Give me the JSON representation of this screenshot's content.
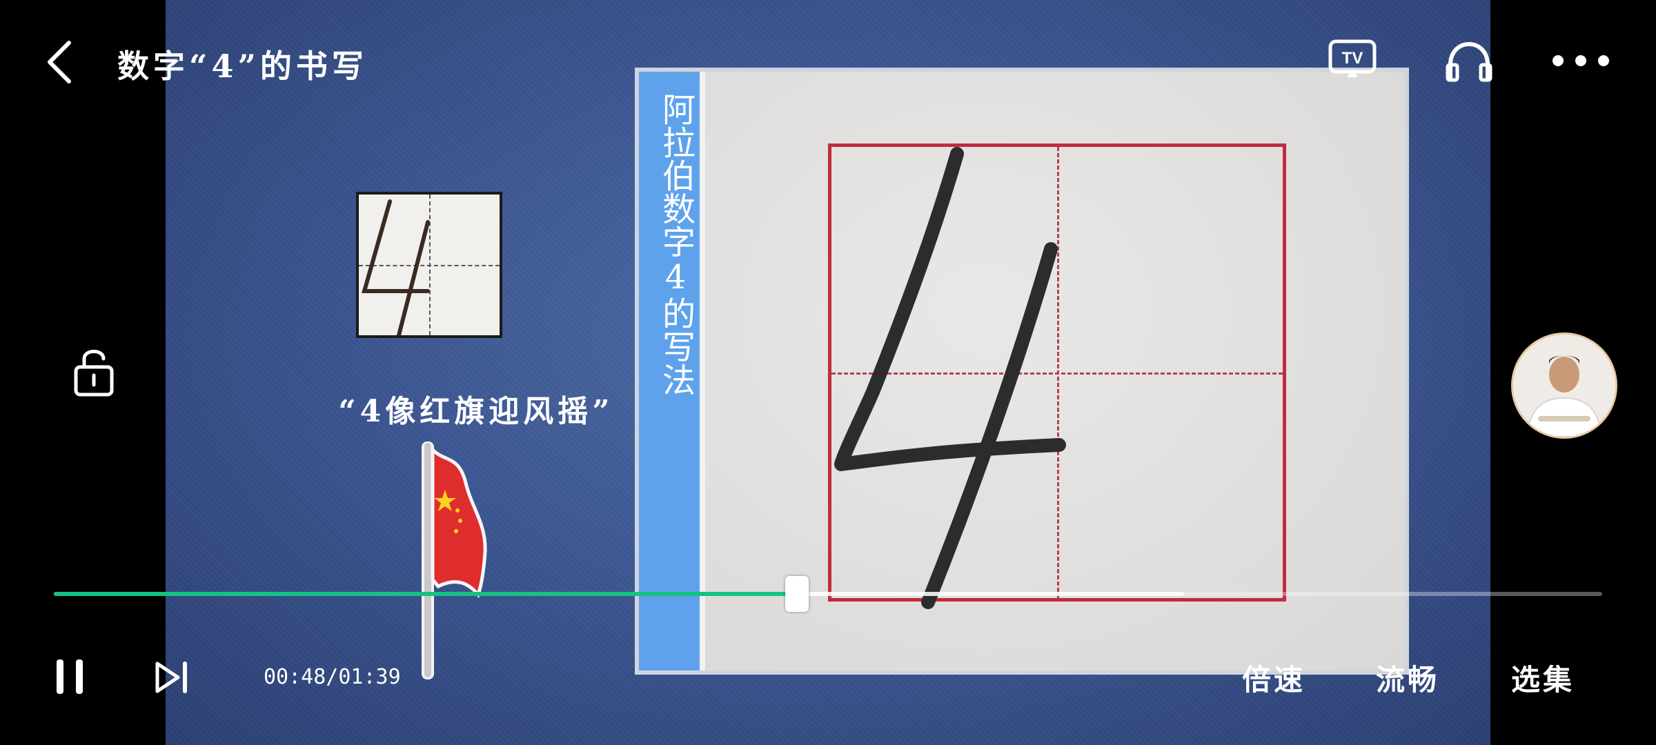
{
  "header": {
    "title": "数字“4”的书写"
  },
  "icons": {
    "back": "back-arrow-icon",
    "cast": "tv-cast-icon",
    "audio": "headphones-icon",
    "more": "more-dots-icon",
    "lock": "lock-icon",
    "pause": "pause-icon",
    "next": "skip-next-icon"
  },
  "video": {
    "caption": "“4像红旗迎风摇”",
    "side_title": "阿拉伯数字4的写法"
  },
  "player": {
    "current_time": "00:48",
    "duration": "01:39",
    "time_display": "00:48/01:39",
    "progress_fraction": 0.48,
    "buffered_fraction": 0.73
  },
  "controls": {
    "speed_label": "倍速",
    "quality_label": "流畅",
    "episodes_label": "选集"
  },
  "colors": {
    "progress_played": "#14c282",
    "strip_blue": "#5ea2ec",
    "grid_red": "#c32a3e"
  }
}
